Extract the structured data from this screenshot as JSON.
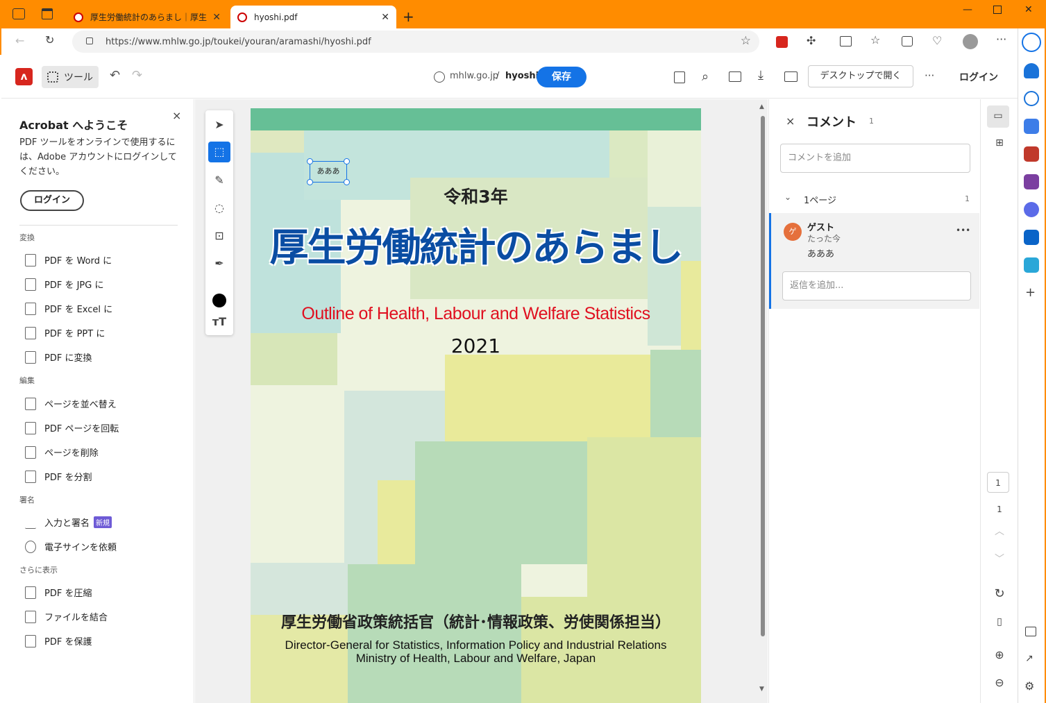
{
  "browser": {
    "tabs": [
      {
        "title": "厚生労働統計のあらまし｜厚生労働省"
      },
      {
        "title": "hyoshi.pdf"
      }
    ],
    "url": "https://www.mhlw.go.jp/toukei/youran/aramashi/hyoshi.pdf"
  },
  "acrobat": {
    "tools_label": "ツール",
    "breadcrumb_domain": "mhlw.go.jp",
    "breadcrumb_sep": "/",
    "file_name": "hyoshi",
    "save_label": "保存",
    "open_desktop_label": "デスクトップで開く",
    "more_label": "···",
    "login_label": "ログイン"
  },
  "left_panel": {
    "close": "×",
    "welcome_title": "Acrobat へようこそ",
    "welcome_body": "PDF ツールをオンラインで使用するには、Adobe アカウントにログインしてください。",
    "login_button": "ログイン",
    "sections": [
      {
        "heading": "変換",
        "items": [
          "PDF を Word に",
          "PDF を JPG に",
          "PDF を Excel に",
          "PDF を PPT に",
          "PDF に変換"
        ]
      },
      {
        "heading": "編集",
        "items": [
          "ページを並べ替え",
          "PDF ページを回転",
          "ページを削除",
          "PDF を分割"
        ]
      },
      {
        "heading": "署名",
        "items": [
          "入力と署名",
          "電子サインを依頼"
        ],
        "new_badge": "新規"
      },
      {
        "heading": "さらに表示",
        "items": [
          "PDF を圧縮",
          "ファイルを結合",
          "PDF を保護"
        ]
      }
    ]
  },
  "pdf": {
    "annotation_text": "あああ",
    "year_jp": "令和3年",
    "title_jp": "厚生労働統計のあらまし",
    "title_en": "Outline of Health, Labour and Welfare Statistics",
    "year": "2021",
    "director_jp": "厚生労働省政策統括官（統計･情報政策、労使関係担当）",
    "director_en": "Director-General for Statistics, Information Policy and Industrial Relations",
    "ministry_en": "Ministry of Health, Labour and Welfare, Japan"
  },
  "comments": {
    "close": "×",
    "title": "コメント",
    "count": "1",
    "add_placeholder": "コメントを追加",
    "page_group": "1ページ",
    "page_count": "1",
    "author": "ゲスト",
    "avatar_letter": "ゲ",
    "time": "たった今",
    "body": "あああ",
    "more": "•••",
    "reply_placeholder": "返信を追加..."
  },
  "rail": {
    "page_current": "1",
    "page_total": "1"
  },
  "colors": {
    "titlebar": "#ff8c00",
    "accent": "#1473e6",
    "acrobat_red": "#d7261e",
    "title_blue": "#0a4da3",
    "title_red": "#e01020"
  }
}
